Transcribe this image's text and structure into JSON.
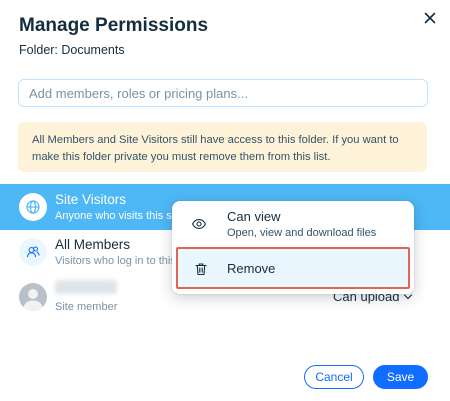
{
  "dialog": {
    "title": "Manage Permissions",
    "subtitle": "Folder: Documents",
    "close_icon": "close-icon"
  },
  "search": {
    "placeholder": "Add members, roles or pricing plans..."
  },
  "notice": {
    "text": "All Members and Site Visitors still have access to this folder. If you want to make this folder private you must remove them from this list."
  },
  "permissions": {
    "site_visitors": {
      "name": "Site Visitors",
      "description": "Anyone who visits this site",
      "icon": "globe-icon"
    },
    "all_members": {
      "name": "All Members",
      "description": "Visitors who log in to this site",
      "icon": "members-icon"
    },
    "user": {
      "role": "Site member",
      "access": "Can upload",
      "icon": "avatar-icon"
    }
  },
  "menu": {
    "view": {
      "label": "Can view",
      "description": "Open, view and download files",
      "icon": "eye-icon"
    },
    "remove": {
      "label": "Remove",
      "icon": "trash-icon"
    }
  },
  "footer": {
    "cancel_label": "Cancel",
    "save_label": "Save"
  },
  "colors": {
    "accent": "#116dff",
    "selected_row": "#4eb7f5",
    "notice_bg": "#fef3d9",
    "highlight_border": "#e2664f"
  }
}
